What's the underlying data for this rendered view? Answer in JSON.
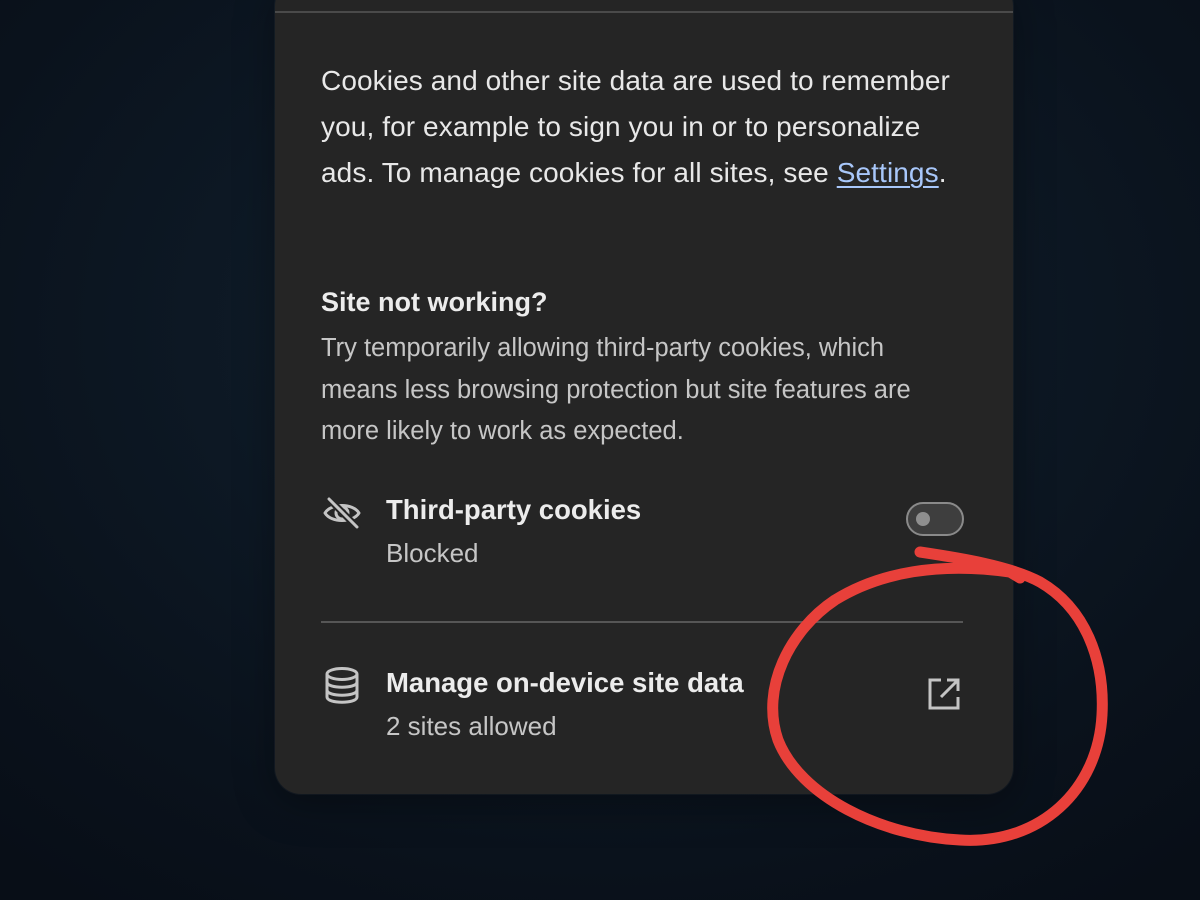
{
  "description": {
    "text_before_link": "Cookies and other site data are used to remember you, for example to sign you in or to personalize ads. To manage cookies for all sites, see ",
    "link_label": "Settings",
    "text_after_link": "."
  },
  "troubleshoot": {
    "heading": "Site not working?",
    "body": "Try temporarily allowing third-party cookies, which means less browsing protection but site features are more likely to work as expected."
  },
  "third_party_cookies": {
    "icon": "eye-off-icon",
    "title": "Third-party cookies",
    "status": "Blocked",
    "toggle_on": false
  },
  "site_data": {
    "icon": "database-icon",
    "title": "Manage on-device site data",
    "subtitle": "2 sites allowed",
    "action_icon": "open-in-new-icon"
  },
  "colors": {
    "panel_background": "#252525",
    "link": "#a8c7fa",
    "annotation_circle": "#e8403a"
  }
}
